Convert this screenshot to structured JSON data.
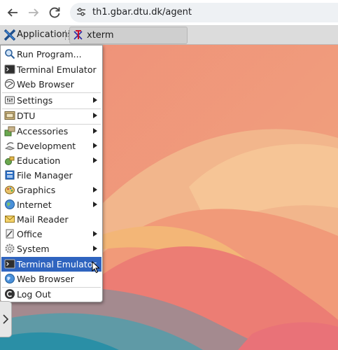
{
  "browser": {
    "back_icon": "arrow-left-icon",
    "forward_icon": "arrow-right-icon",
    "reload_icon": "reload-icon",
    "url": "th1.gbar.dtu.dk/agent"
  },
  "panel": {
    "applications_label": "Applications",
    "task_label": "xterm"
  },
  "menu": {
    "items": [
      {
        "label": "Run Program...",
        "icon": "search-icon"
      },
      {
        "label": "Terminal Emulator",
        "icon": "terminal-icon"
      },
      {
        "label": "Web Browser",
        "icon": "globe-icon"
      },
      {
        "label": "Settings",
        "icon": "settings-icon"
      },
      {
        "label": "DTU",
        "icon": "dtu-icon"
      },
      {
        "label": "Accessories",
        "icon": "accessories-icon"
      },
      {
        "label": "Development",
        "icon": "development-icon"
      },
      {
        "label": "Education",
        "icon": "education-icon"
      },
      {
        "label": "File Manager",
        "icon": "file-manager-icon"
      },
      {
        "label": "Graphics",
        "icon": "graphics-icon"
      },
      {
        "label": "Internet",
        "icon": "internet-icon"
      },
      {
        "label": "Mail Reader",
        "icon": "mail-icon"
      },
      {
        "label": "Office",
        "icon": "office-icon"
      },
      {
        "label": "System",
        "icon": "system-gear-icon"
      },
      {
        "label": "Terminal Emulator",
        "icon": "terminal-icon"
      },
      {
        "label": "Web Browser",
        "icon": "globe-icon"
      },
      {
        "label": "Log Out",
        "icon": "logout-icon"
      }
    ]
  },
  "colors": {
    "selection": "#2f64bf",
    "panel": "#dcdcdc"
  }
}
